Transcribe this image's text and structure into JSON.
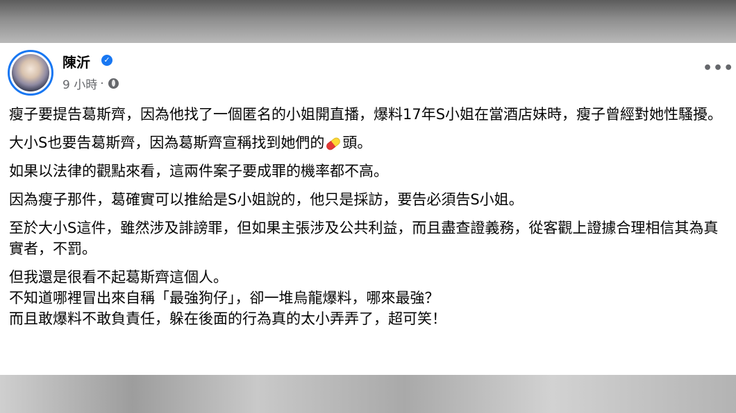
{
  "post": {
    "author": "陳沂",
    "verified_icon": "verified-badge-icon",
    "time": "9 小時",
    "dot": "·",
    "privacy_icon": "globe-icon",
    "more_label": "•••",
    "paragraphs": {
      "p1": "瘦子要提告葛斯齊，因為他找了一個匿名的小姐開直播，爆料17年S小姐在當酒店妹時，瘦子曾經對她性騷擾。",
      "p2_before": "大小S也要告葛斯齊，因為葛斯齊宣稱找到她們的",
      "p2_emoji": "pill-icon",
      "p2_after": "頭。",
      "p3": "如果以法律的觀點來看，這兩件案子要成罪的機率都不高。",
      "p4": "因為瘦子那件，葛確實可以推給是S小姐說的，他只是採訪，要告必須告S小姐。",
      "p5": "至於大小S這件，雖然涉及誹謗罪，但如果主張涉及公共利益，而且盡查證義務，從客觀上證據合理相信其為真實者，不罰。",
      "p6_line1": "但我還是很看不起葛斯齊這個人。",
      "p6_line2": "不知道哪裡冒出來自稱「最強狗仔」，卻一堆烏龍爆料，哪來最強？",
      "p6_line3": "而且敢爆料不敢負責任，躲在後面的行為真的太小弄弄了，超可笑！"
    }
  },
  "colors": {
    "accent": "#1877f2",
    "meta": "#65676b",
    "text": "#050505"
  }
}
